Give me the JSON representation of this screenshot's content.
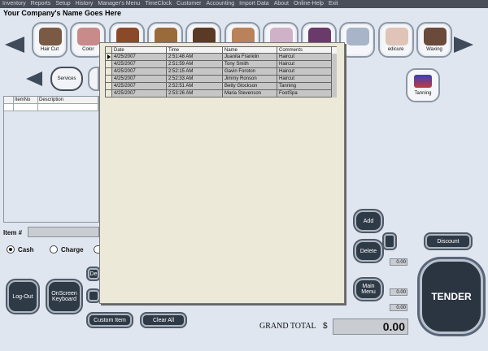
{
  "menu": [
    "Inventory",
    "Reports",
    "Setup",
    "History",
    "Manager's Menu",
    "TimeClock",
    "Customer",
    "Accounting",
    "Import Data",
    "About",
    "Online-Help",
    "Exit"
  ],
  "company_name": "Your Company's Name Goes Here",
  "services_top": [
    {
      "label": "Hair Cut",
      "color": "#7a5a45"
    },
    {
      "label": "Color",
      "color": "#c98a8a"
    },
    {
      "label": "",
      "color": "#8a4a2a"
    },
    {
      "label": "",
      "color": "#9a6a3a"
    },
    {
      "label": "",
      "color": "#5a3a25"
    },
    {
      "label": "",
      "color": "#b9825a"
    },
    {
      "label": "",
      "color": "#d0b2c8"
    },
    {
      "label": "",
      "color": "#6a3a6a"
    },
    {
      "label": "",
      "color": "#a8b4c8"
    },
    {
      "label": "edicure",
      "color": "#e0c4b8"
    },
    {
      "label": "Waxing",
      "color": "#6a4a3a"
    }
  ],
  "services_label": "Services",
  "tanning_label": "Tanning",
  "items_table": {
    "headers": [
      "",
      "ItemNo",
      "Description"
    ]
  },
  "item_label": "Item #",
  "payment": {
    "cash": "Cash",
    "charge": "Charge"
  },
  "buttons": {
    "logout": "Log-Out",
    "keyboard": "OnScreen Keyboard",
    "partial1": "De",
    "custom_item": "Custom Item",
    "clear_all": "Clear All",
    "add": "Add",
    "delete": "Delete",
    "main_menu": "Main Menu",
    "discount": "Discount",
    "tender": "TENDER"
  },
  "totals": {
    "field1": "0.00",
    "field2": "0.00",
    "field3": "0.00"
  },
  "grand_total": {
    "label": "GRAND TOTAL",
    "currency": "$",
    "value": "0.00"
  },
  "appointments": {
    "headers": [
      "Date",
      "Time",
      "Name",
      "Comments"
    ],
    "rows": [
      {
        "date": "4/25/2007",
        "time": "2:51:48 AM",
        "name": "Juanita Franklin",
        "comments": "Haircut"
      },
      {
        "date": "4/25/2007",
        "time": "2:51:59 AM",
        "name": "Tony Smith",
        "comments": "Haircut"
      },
      {
        "date": "4/25/2007",
        "time": "2:52:15 AM",
        "name": "Gavin Foroton",
        "comments": "Haircut"
      },
      {
        "date": "4/25/2007",
        "time": "2:52:33 AM",
        "name": "Jimmy Ronson",
        "comments": "Haircut"
      },
      {
        "date": "4/25/2007",
        "time": "2:52:51 AM",
        "name": "Betty Glockson",
        "comments": "Tanning"
      },
      {
        "date": "4/25/2007",
        "time": "2:53:26 AM",
        "name": "Maria Stevenson",
        "comments": "FootSpa"
      }
    ]
  }
}
